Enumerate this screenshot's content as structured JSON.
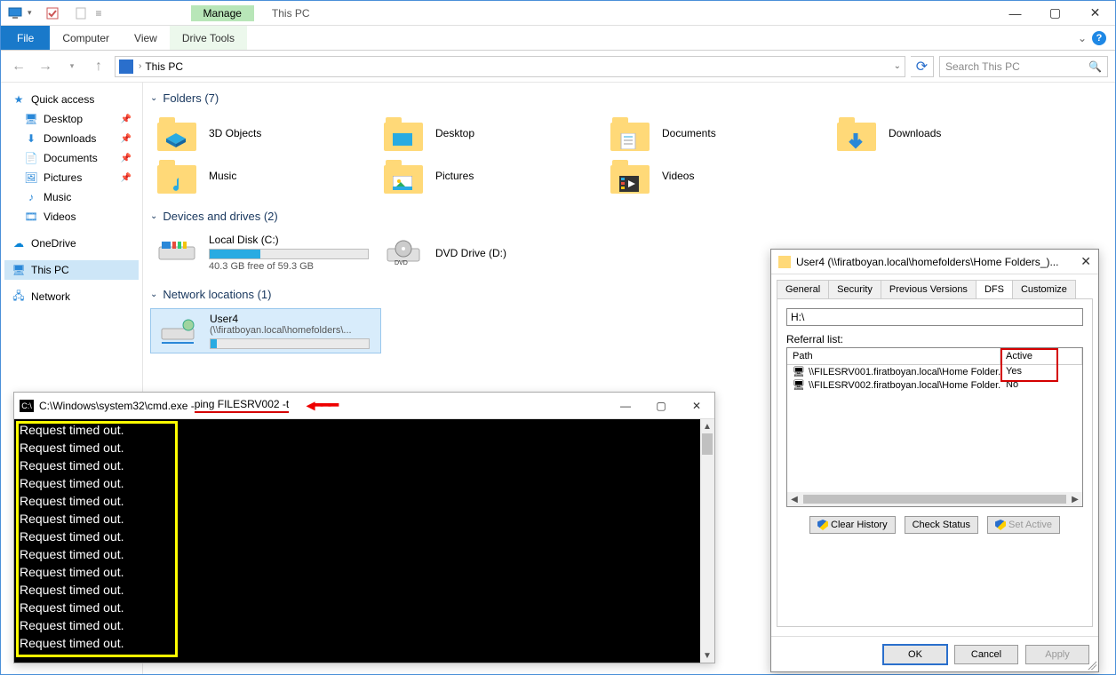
{
  "titlebar": {
    "manage": "Manage",
    "title": "This PC"
  },
  "ribbon": {
    "file": "File",
    "computer": "Computer",
    "view": "View",
    "drivetools": "Drive Tools"
  },
  "nav": {
    "path": "This PC",
    "search_placeholder": "Search This PC"
  },
  "sidebar": {
    "quick": "Quick access",
    "items": [
      "Desktop",
      "Downloads",
      "Documents",
      "Pictures",
      "Music",
      "Videos"
    ],
    "onedrive": "OneDrive",
    "thispc": "This PC",
    "network": "Network"
  },
  "sections": {
    "folders": "Folders (7)",
    "drives": "Devices and drives (2)",
    "netloc": "Network locations (1)"
  },
  "folders": [
    "3D Objects",
    "Desktop",
    "Documents",
    "Downloads",
    "Music",
    "Pictures",
    "Videos"
  ],
  "drives": {
    "c_name": "Local Disk (C:)",
    "c_free": "40.3 GB free of 59.3 GB",
    "c_fill_pct": 32,
    "dvd": "DVD Drive (D:)"
  },
  "netloc": {
    "name": "User4",
    "path": "(\\\\firatboyan.local\\homefolders\\..."
  },
  "cmd": {
    "title_prefix": "C:\\Windows\\system32\\cmd.exe - ",
    "title_cmd": "ping  FILESRV002 -t",
    "line": "Request timed out.",
    "repeat": 13
  },
  "prop": {
    "title": "User4 (\\\\firatboyan.local\\homefolders\\Home Folders_)...",
    "tabs": [
      "General",
      "Security",
      "Previous Versions",
      "DFS",
      "Customize"
    ],
    "active_tab": "DFS",
    "path": "H:\\",
    "referral_label": "Referral list:",
    "col_path": "Path",
    "col_active": "Active",
    "rows": [
      {
        "path": "\\\\FILESRV001.firatboyan.local\\Home Folder...",
        "active": "Yes"
      },
      {
        "path": "\\\\FILESRV002.firatboyan.local\\Home Folder...",
        "active": "No"
      }
    ],
    "btn_clear": "Clear History",
    "btn_check": "Check Status",
    "btn_setactive": "Set Active",
    "ok": "OK",
    "cancel": "Cancel",
    "apply": "Apply"
  }
}
